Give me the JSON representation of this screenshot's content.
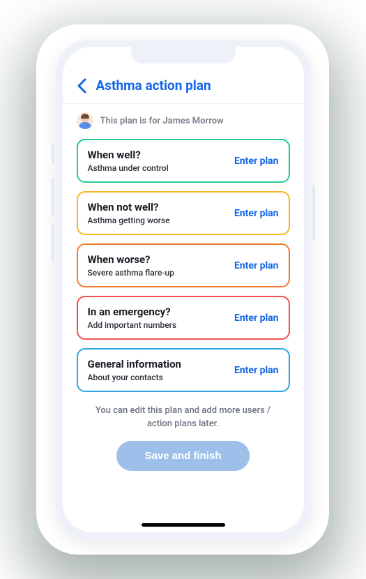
{
  "header": {
    "title": "Asthma action plan"
  },
  "user": {
    "label": "This plan is for James Morrow"
  },
  "cards": [
    {
      "title": "When well?",
      "subtitle": "Asthma under control",
      "action": "Enter plan",
      "colorClass": "c-green"
    },
    {
      "title": "When not well?",
      "subtitle": "Asthma getting worse",
      "action": "Enter plan",
      "colorClass": "c-yellow"
    },
    {
      "title": "When worse?",
      "subtitle": "Severe asthma flare-up",
      "action": "Enter plan",
      "colorClass": "c-orange"
    },
    {
      "title": "In an emergency?",
      "subtitle": "Add important numbers",
      "action": "Enter plan",
      "colorClass": "c-red"
    },
    {
      "title": "General information",
      "subtitle": "About your contacts",
      "action": "Enter plan",
      "colorClass": "c-blue"
    }
  ],
  "footer": {
    "note": "You can edit this plan and add more users / action plans later.",
    "save": "Save and finish"
  }
}
